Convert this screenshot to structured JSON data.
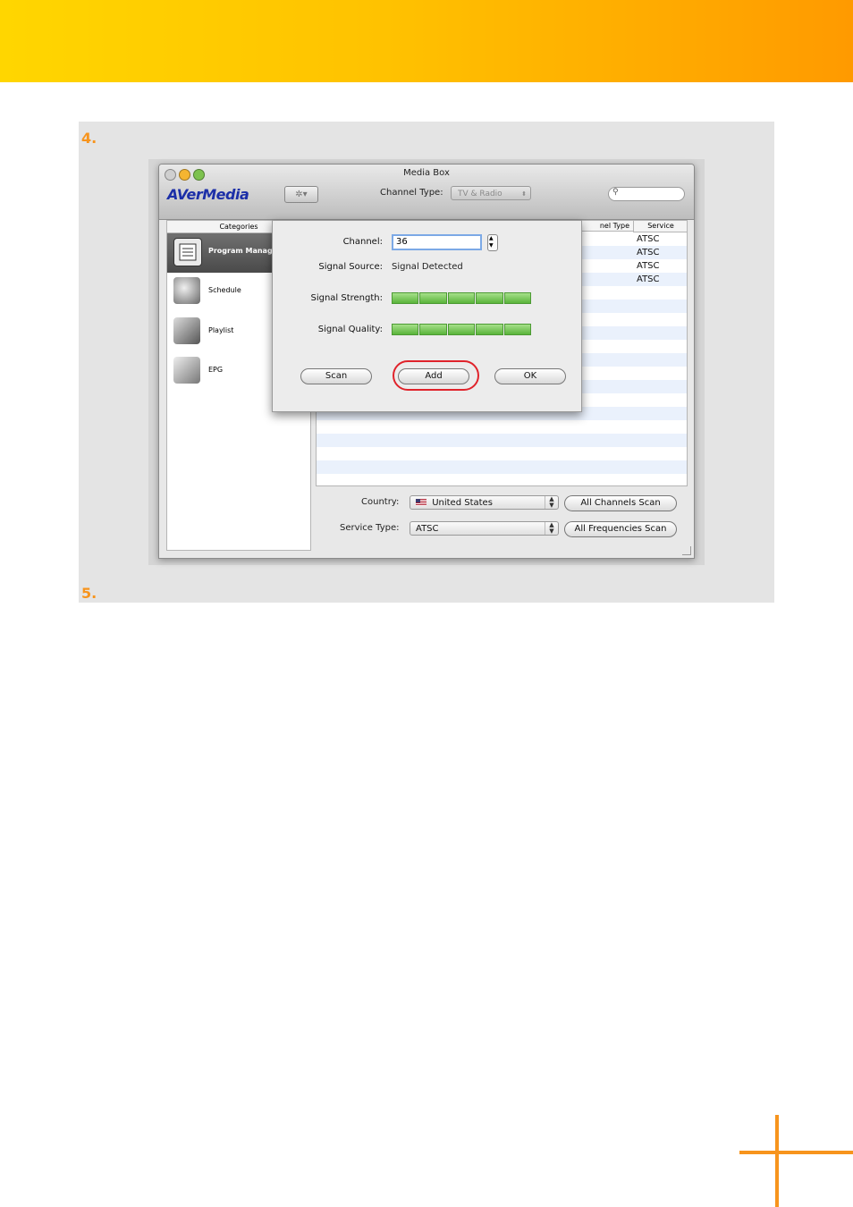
{
  "steps": [
    "4.",
    "5."
  ],
  "window": {
    "title": "Media Box",
    "logo": "AVerMedia",
    "channel_type_label": "Channel Type:",
    "channel_type_value": "TV & Radio",
    "search_placeholder": ""
  },
  "sidebar": {
    "header": "Categories",
    "items": [
      {
        "label": "Program Manage",
        "selected": true
      },
      {
        "label": "Schedule"
      },
      {
        "label": "Playlist"
      },
      {
        "label": "EPG"
      }
    ]
  },
  "table": {
    "headers": [
      "nel Type",
      "Service"
    ],
    "services": [
      "ATSC",
      "ATSC",
      "ATSC",
      "ATSC"
    ]
  },
  "dialog": {
    "channel_label": "Channel:",
    "channel_value": "36",
    "signal_source_label": "Signal Source:",
    "signal_source_value": "Signal Detected",
    "signal_strength_label": "Signal Strength:",
    "signal_quality_label": "Signal Quality:",
    "signal_strength_level": 1.0,
    "signal_quality_level": 1.0,
    "scan_button": "Scan",
    "add_button": "Add",
    "ok_button": "OK",
    "highlight_color": "#e0232b"
  },
  "bottom": {
    "country_label": "Country:",
    "country_value": "United States",
    "country_flag_icon": "us-flag-icon",
    "service_type_label": "Service Type:",
    "service_type_value": "ATSC",
    "all_channels_scan": "All Channels Scan",
    "all_frequencies_scan": "All Frequencies Scan"
  },
  "colors": {
    "accent_orange": "#f7941d",
    "banner_start": "#ffd600",
    "banner_end": "#ff9a00"
  }
}
